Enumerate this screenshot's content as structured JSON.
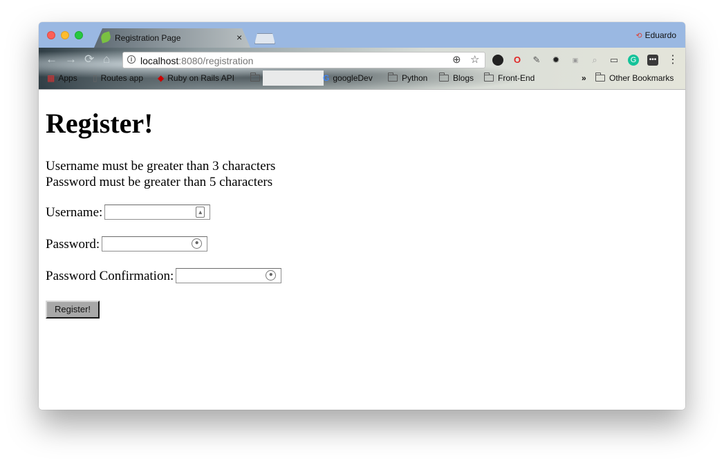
{
  "browser": {
    "tab": {
      "title": "Registration Page",
      "close": "×"
    },
    "profile": {
      "name": "Eduardo",
      "icon": "sync-error-icon"
    },
    "nav": {
      "back": "←",
      "forward": "→",
      "reload": "⟳",
      "home": "⌂"
    },
    "omnibox": {
      "host": "localhost",
      "rest": ":8080/registration",
      "info": "i",
      "zoom": "⊕",
      "star": "☆"
    },
    "bookmarks": [
      {
        "label": "Apps",
        "kind": "apps"
      },
      {
        "label": "Routes app",
        "kind": "page"
      },
      {
        "label": "Ruby on Rails API",
        "kind": "rails"
      },
      {
        "label": "",
        "kind": "folder"
      },
      {
        "label": "googleDev",
        "kind": "google"
      },
      {
        "label": "Python",
        "kind": "folder"
      },
      {
        "label": "Blogs",
        "kind": "folder"
      },
      {
        "label": "Front-End",
        "kind": "folder"
      },
      {
        "label": "Other Bookmarks",
        "kind": "folder"
      }
    ],
    "overflow": "»",
    "menu": "⋮"
  },
  "page": {
    "heading": "Register!",
    "rules": [
      "Username must be greater than 3 characters",
      "Password must be greater than 5 characters"
    ],
    "fields": {
      "username_label": "Username:",
      "password_label": "Password:",
      "confirm_label": "Password Confirmation:"
    },
    "submit_label": "Register!"
  }
}
